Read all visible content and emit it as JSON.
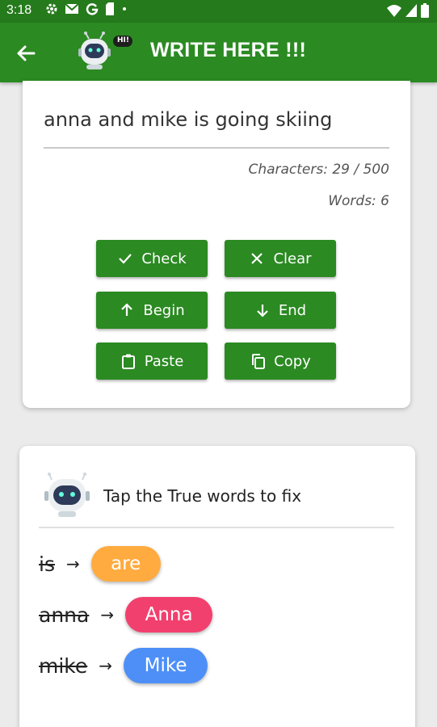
{
  "status_bar": {
    "time": "3:18",
    "left_icons": [
      "gear-icon",
      "mail-icon",
      "google-icon",
      "sim-icon",
      "dot-icon"
    ],
    "right_icons": [
      "wifi-icon",
      "signal-icon",
      "battery-icon"
    ]
  },
  "app_bar": {
    "title": "WRITE HERE !!!",
    "logo_badge": "HI!",
    "color": "#2b8a22"
  },
  "editor": {
    "text": "anna and mike is going skiing",
    "characters": "Characters: 29 / 500",
    "words": "Words: 6"
  },
  "buttons": {
    "check": "Check",
    "clear": "Clear",
    "begin": "Begin",
    "end": "End",
    "paste": "Paste",
    "copy": "Copy"
  },
  "suggestions": {
    "hint": "Tap the True words to fix",
    "items": [
      {
        "wrong": "is",
        "correct": "are",
        "color": "#ffab40"
      },
      {
        "wrong": "anna",
        "correct": "Anna",
        "color": "#f2406e"
      },
      {
        "wrong": "mike",
        "correct": "Mike",
        "color": "#4d8ff7"
      }
    ]
  }
}
